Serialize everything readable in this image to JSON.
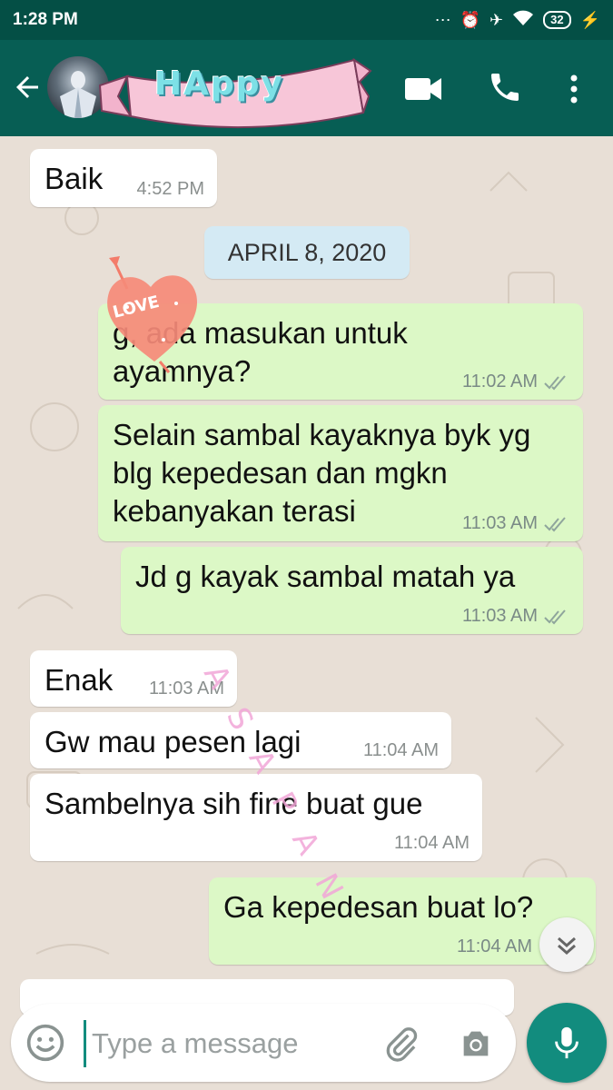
{
  "status_bar": {
    "time": "1:28 PM",
    "battery": "32"
  },
  "header": {
    "banner_text": "HAppy"
  },
  "chat": {
    "messages": [
      {
        "dir": "in",
        "text": "Baik",
        "time": "4:52 PM"
      },
      {
        "dir": "out",
        "text": "g, ada masukan untuk ayamnya?",
        "time": "11:02 AM"
      },
      {
        "dir": "out",
        "text": "Selain sambal kayaknya byk yg blg kepedesan dan mgkn kebanyakan terasi",
        "time": "11:03 AM"
      },
      {
        "dir": "out",
        "text": "Jd g kayak sambal matah ya",
        "time": "11:03 AM"
      },
      {
        "dir": "in",
        "text": "Enak",
        "time": "11:03 AM"
      },
      {
        "dir": "in",
        "text": "Gw mau pesen lagi",
        "time": "11:04 AM"
      },
      {
        "dir": "in",
        "text": "Sambelnya sih fine buat gue",
        "time": "11:04 AM"
      },
      {
        "dir": "out",
        "text": "Ga kepedesan buat lo?",
        "time": "11:04 AM"
      }
    ],
    "date_divider": "APRIL 8, 2020",
    "stickers": {
      "heart_text": "LOVE",
      "watermark": "ASAPAN"
    }
  },
  "composer": {
    "placeholder": "Type a message"
  },
  "colors": {
    "header": "#075e54",
    "status": "#044f45",
    "outgoing": "#dcf8c6",
    "accent": "#128c7e"
  }
}
